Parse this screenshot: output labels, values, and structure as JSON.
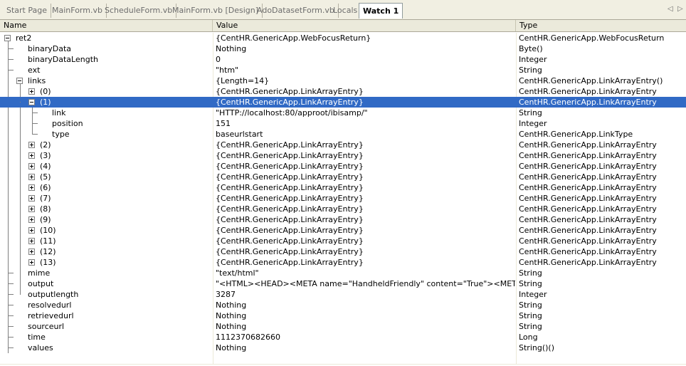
{
  "tabs": [
    "Start Page",
    "MainForm.vb",
    "ScheduleForm.vb",
    "MainForm.vb [Design]",
    "AdoDatasetForm.vb",
    "Locals",
    "Watch 1"
  ],
  "nav": {
    "left": "◁",
    "right": "▷"
  },
  "columns": {
    "name": "Name",
    "value": "Value",
    "type": "Type"
  },
  "rows": [
    {
      "name": "ret2",
      "value": "{CentHR.GenericApp.WebFocusReturn}",
      "type": "CentHR.GenericApp.WebFocusReturn"
    },
    {
      "name": "binaryData",
      "value": "Nothing",
      "type": "Byte()"
    },
    {
      "name": "binaryDataLength",
      "value": "0",
      "type": "Integer"
    },
    {
      "name": "ext",
      "value": "\"htm\"",
      "type": "String"
    },
    {
      "name": "links",
      "value": "{Length=14}",
      "type": "CentHR.GenericApp.LinkArrayEntry()"
    },
    {
      "name": "(0)",
      "value": "{CentHR.GenericApp.LinkArrayEntry}",
      "type": "CentHR.GenericApp.LinkArrayEntry"
    },
    {
      "name": "(1)",
      "value": "{CentHR.GenericApp.LinkArrayEntry}",
      "type": "CentHR.GenericApp.LinkArrayEntry"
    },
    {
      "name": "link",
      "value": "\"HTTP://localhost:80/approot/ibisamp/\"",
      "type": "String"
    },
    {
      "name": "position",
      "value": "151",
      "type": "Integer"
    },
    {
      "name": "type",
      "value": "baseurlstart",
      "type": "CentHR.GenericApp.LinkType"
    },
    {
      "name": "(2)",
      "value": "{CentHR.GenericApp.LinkArrayEntry}",
      "type": "CentHR.GenericApp.LinkArrayEntry"
    },
    {
      "name": "(3)",
      "value": "{CentHR.GenericApp.LinkArrayEntry}",
      "type": "CentHR.GenericApp.LinkArrayEntry"
    },
    {
      "name": "(4)",
      "value": "{CentHR.GenericApp.LinkArrayEntry}",
      "type": "CentHR.GenericApp.LinkArrayEntry"
    },
    {
      "name": "(5)",
      "value": "{CentHR.GenericApp.LinkArrayEntry}",
      "type": "CentHR.GenericApp.LinkArrayEntry"
    },
    {
      "name": "(6)",
      "value": "{CentHR.GenericApp.LinkArrayEntry}",
      "type": "CentHR.GenericApp.LinkArrayEntry"
    },
    {
      "name": "(7)",
      "value": "{CentHR.GenericApp.LinkArrayEntry}",
      "type": "CentHR.GenericApp.LinkArrayEntry"
    },
    {
      "name": "(8)",
      "value": "{CentHR.GenericApp.LinkArrayEntry}",
      "type": "CentHR.GenericApp.LinkArrayEntry"
    },
    {
      "name": "(9)",
      "value": "{CentHR.GenericApp.LinkArrayEntry}",
      "type": "CentHR.GenericApp.LinkArrayEntry"
    },
    {
      "name": "(10)",
      "value": "{CentHR.GenericApp.LinkArrayEntry}",
      "type": "CentHR.GenericApp.LinkArrayEntry"
    },
    {
      "name": "(11)",
      "value": "{CentHR.GenericApp.LinkArrayEntry}",
      "type": "CentHR.GenericApp.LinkArrayEntry"
    },
    {
      "name": "(12)",
      "value": "{CentHR.GenericApp.LinkArrayEntry}",
      "type": "CentHR.GenericApp.LinkArrayEntry"
    },
    {
      "name": "(13)",
      "value": "{CentHR.GenericApp.LinkArrayEntry}",
      "type": "CentHR.GenericApp.LinkArrayEntry"
    },
    {
      "name": "mime",
      "value": "\"text/html\"",
      "type": "String"
    },
    {
      "name": "output",
      "value": "\"<HTML><HEAD><META name=\"HandheldFriendly\" content=\"True\"><META name=\"P",
      "type": "String"
    },
    {
      "name": "outputlength",
      "value": "3287",
      "type": "Integer"
    },
    {
      "name": "resolvedurl",
      "value": "Nothing",
      "type": "String"
    },
    {
      "name": "retrievedurl",
      "value": "Nothing",
      "type": "String"
    },
    {
      "name": "sourceurl",
      "value": "Nothing",
      "type": "String"
    },
    {
      "name": "time",
      "value": "1112370682660",
      "type": "Long"
    },
    {
      "name": "values",
      "value": "Nothing",
      "type": "String()()"
    }
  ]
}
